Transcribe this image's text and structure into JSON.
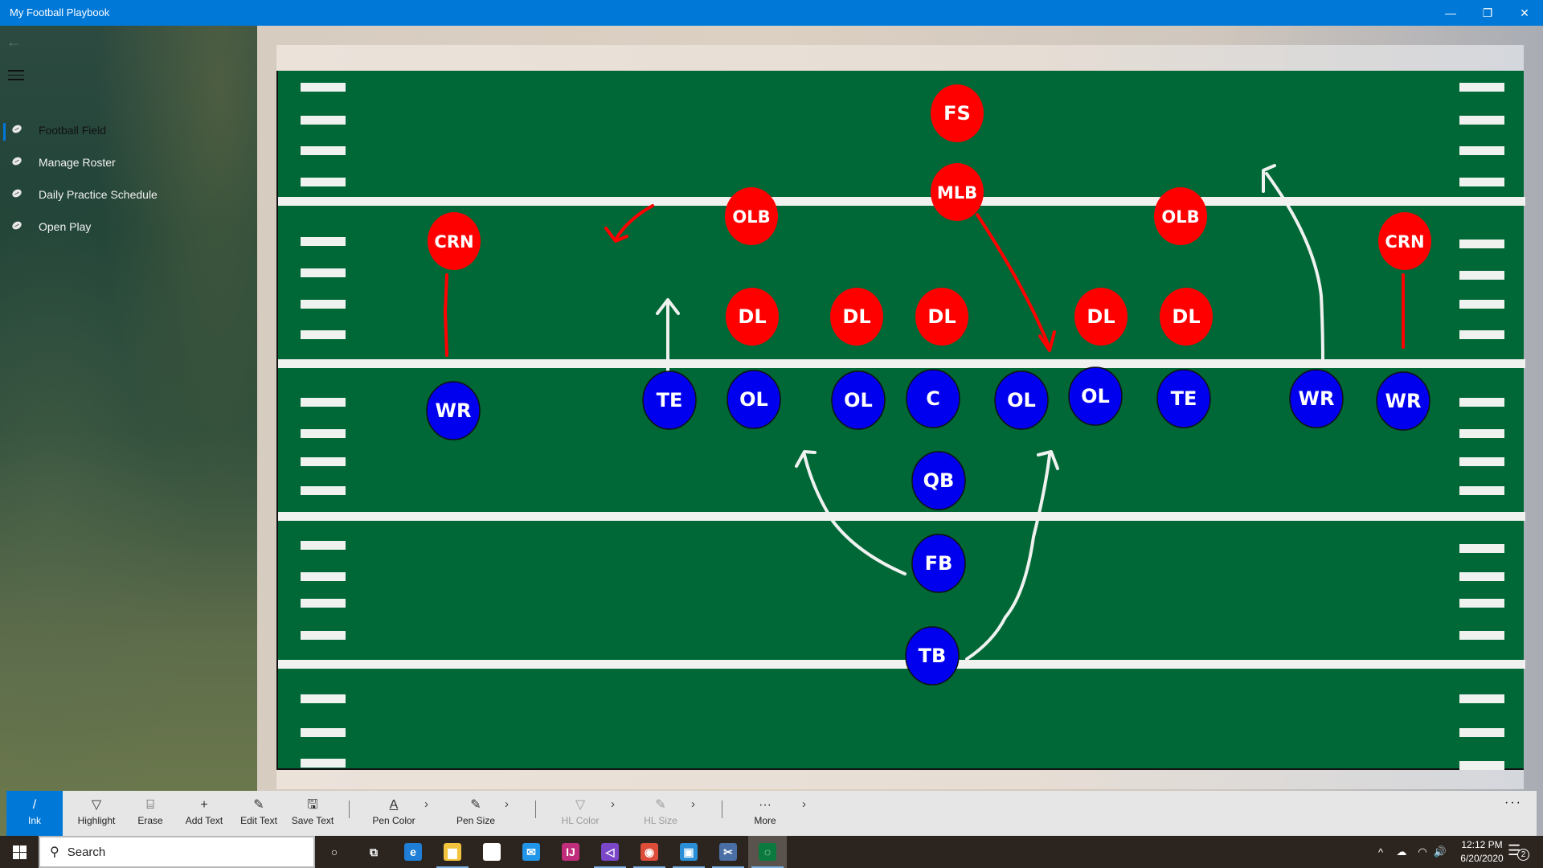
{
  "window": {
    "title": "My Football Playbook",
    "controls": {
      "minimize": "—",
      "restore": "❐",
      "close": "✕"
    }
  },
  "sidebar": {
    "back_icon": "←",
    "items": [
      {
        "label": "Football Field",
        "icon": "football-icon",
        "selected": true
      },
      {
        "label": "Manage Roster",
        "icon": "football-icon",
        "selected": false
      },
      {
        "label": "Daily Practice Schedule",
        "icon": "football-icon",
        "selected": false
      },
      {
        "label": "Open Play",
        "icon": "football-icon",
        "selected": false
      }
    ]
  },
  "field": {
    "colors": {
      "turf": "#006837",
      "lines": "#f0f2f0",
      "defense": "#ff0000",
      "offense": "#0000ee",
      "text": "#ffffff"
    },
    "defense": [
      {
        "label": "FS"
      },
      {
        "label": "MLB"
      },
      {
        "label": "OLB"
      },
      {
        "label": "OLB"
      },
      {
        "label": "CRN"
      },
      {
        "label": "CRN"
      },
      {
        "label": "DL"
      },
      {
        "label": "DL"
      },
      {
        "label": "DL"
      },
      {
        "label": "DL"
      },
      {
        "label": "DL"
      }
    ],
    "offense": [
      {
        "label": "WR"
      },
      {
        "label": "TE"
      },
      {
        "label": "OL"
      },
      {
        "label": "OL"
      },
      {
        "label": "C"
      },
      {
        "label": "OL"
      },
      {
        "label": "OL"
      },
      {
        "label": "TE"
      },
      {
        "label": "WR"
      },
      {
        "label": "WR"
      },
      {
        "label": "QB"
      },
      {
        "label": "FB"
      },
      {
        "label": "TB"
      }
    ]
  },
  "commandbar": {
    "commands": [
      {
        "label": "Ink",
        "icon": "/",
        "state": "active"
      },
      {
        "label": "Highlight",
        "icon": "▽",
        "state": "normal"
      },
      {
        "label": "Erase",
        "icon": "⌸",
        "state": "normal"
      },
      {
        "label": "Add Text",
        "icon": "+",
        "state": "normal"
      },
      {
        "label": "Edit Text",
        "icon": "✎",
        "state": "normal"
      },
      {
        "label": "Save Text",
        "icon": "🖫",
        "state": "normal"
      },
      {
        "label": "Pen Color",
        "icon": "A",
        "state": "normal"
      },
      {
        "label": "Pen Size",
        "icon": "✎",
        "state": "normal"
      },
      {
        "label": "HL Color",
        "icon": "▽",
        "state": "disabled"
      },
      {
        "label": "HL Size",
        "icon": "✎",
        "state": "disabled"
      },
      {
        "label": "More",
        "icon": "···",
        "state": "normal"
      }
    ],
    "chevron": "›",
    "overflow": "···"
  },
  "taskbar": {
    "search_placeholder": "Search",
    "apps": [
      {
        "name": "cortana",
        "glyph": "○",
        "color": "transparent"
      },
      {
        "name": "task-view",
        "glyph": "⧉",
        "color": "transparent"
      },
      {
        "name": "edge",
        "glyph": "e",
        "color": "#1f7fd6"
      },
      {
        "name": "file-explorer",
        "glyph": "▆",
        "color": "#f2c33c"
      },
      {
        "name": "store",
        "glyph": "▦",
        "color": "#ffffff"
      },
      {
        "name": "mail",
        "glyph": "✉",
        "color": "#2196e8"
      },
      {
        "name": "intellij",
        "glyph": "IJ",
        "color": "#c02d7a"
      },
      {
        "name": "visual-studio",
        "glyph": "◁",
        "color": "#7b47c9"
      },
      {
        "name": "chrome",
        "glyph": "◉",
        "color": "#dd4b39"
      },
      {
        "name": "intel-graphics",
        "glyph": "▣",
        "color": "#2a8fd6"
      },
      {
        "name": "snipping-tool",
        "glyph": "✂",
        "color": "#4a6fa5"
      },
      {
        "name": "football-playbook",
        "glyph": "◌",
        "color": "#0b7a3e"
      }
    ],
    "tray": {
      "chevron": "^",
      "onedrive": "☁",
      "wifi": "◠",
      "volume": "🔊"
    },
    "time": "12:12 PM",
    "date": "6/20/2020",
    "notifications": "2"
  }
}
